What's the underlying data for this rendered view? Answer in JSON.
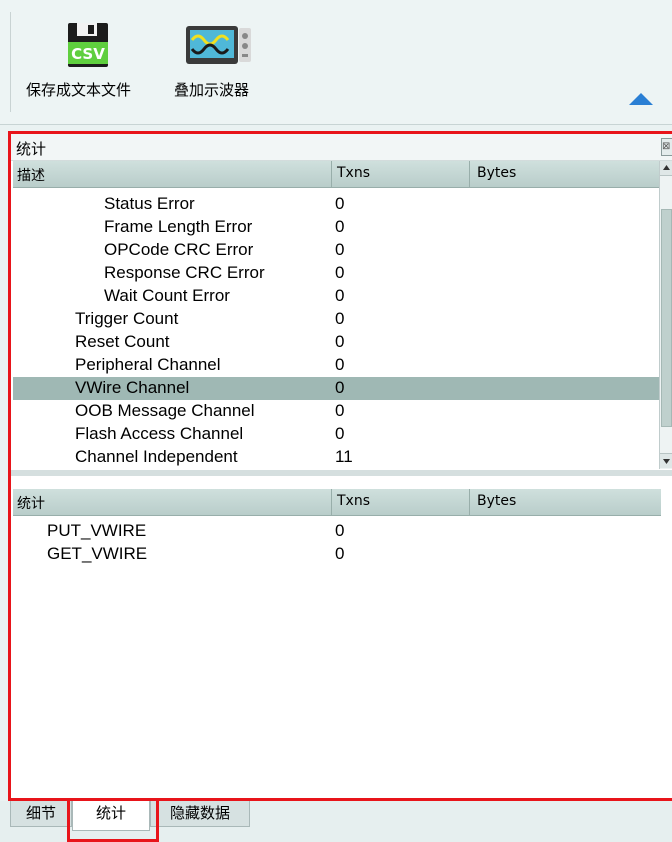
{
  "toolbar": {
    "buttons": [
      {
        "label": "保存成文本文件",
        "icon": "csv-file-icon",
        "icon_text": "CSV"
      },
      {
        "label": "叠加示波器",
        "icon": "oscilloscope-icon"
      }
    ],
    "collapse_icon": "triangle-up-icon"
  },
  "panel": {
    "title": "统计",
    "close_glyph": "⊠",
    "top_table": {
      "columns": [
        "描述",
        "Txns",
        "Bytes"
      ],
      "rows": [
        {
          "desc": "Status Error",
          "txns": "0",
          "level": 2
        },
        {
          "desc": "Frame Length Error",
          "txns": "0",
          "level": 2
        },
        {
          "desc": "OPCode CRC Error",
          "txns": "0",
          "level": 2
        },
        {
          "desc": "Response CRC Error",
          "txns": "0",
          "level": 2
        },
        {
          "desc": "Wait Count Error",
          "txns": "0",
          "level": 2
        },
        {
          "desc": "Trigger Count",
          "txns": "0",
          "level": 1
        },
        {
          "desc": "Reset Count",
          "txns": "0",
          "level": 1
        },
        {
          "desc": "Peripheral Channel",
          "txns": "0",
          "level": 1
        },
        {
          "desc": "VWire Channel",
          "txns": "0",
          "level": 1,
          "selected": true
        },
        {
          "desc": "OOB Message Channel",
          "txns": "0",
          "level": 1
        },
        {
          "desc": "Flash Access Channel",
          "txns": "0",
          "level": 1
        },
        {
          "desc": "Channel Independent",
          "txns": "11",
          "level": 1
        }
      ]
    },
    "bottom_table": {
      "columns": [
        "统计",
        "Txns",
        "Bytes"
      ],
      "rows": [
        {
          "desc": "PUT_VWIRE",
          "txns": "0"
        },
        {
          "desc": "GET_VWIRE",
          "txns": "0"
        }
      ]
    }
  },
  "tabs": [
    {
      "label": "细节",
      "active": false
    },
    {
      "label": "统计",
      "active": true
    },
    {
      "label": "隐藏数据",
      "active": false
    }
  ],
  "colors": {
    "highlight_border": "#e8141a",
    "selected_row": "#9fb8b4",
    "header": "#c4d7d4"
  }
}
